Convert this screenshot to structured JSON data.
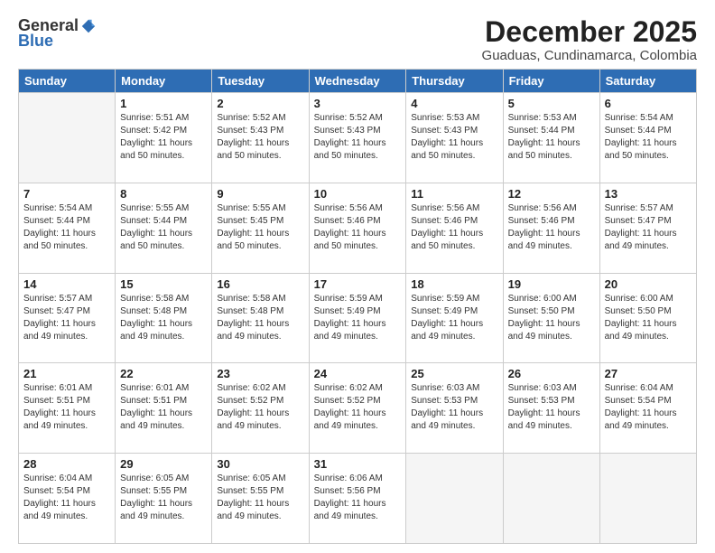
{
  "logo": {
    "general": "General",
    "blue": "Blue"
  },
  "title": "December 2025",
  "subtitle": "Guaduas, Cundinamarca, Colombia",
  "weekdays": [
    "Sunday",
    "Monday",
    "Tuesday",
    "Wednesday",
    "Thursday",
    "Friday",
    "Saturday"
  ],
  "weeks": [
    [
      {
        "day": "",
        "info": ""
      },
      {
        "day": "1",
        "info": "Sunrise: 5:51 AM\nSunset: 5:42 PM\nDaylight: 11 hours\nand 50 minutes."
      },
      {
        "day": "2",
        "info": "Sunrise: 5:52 AM\nSunset: 5:43 PM\nDaylight: 11 hours\nand 50 minutes."
      },
      {
        "day": "3",
        "info": "Sunrise: 5:52 AM\nSunset: 5:43 PM\nDaylight: 11 hours\nand 50 minutes."
      },
      {
        "day": "4",
        "info": "Sunrise: 5:53 AM\nSunset: 5:43 PM\nDaylight: 11 hours\nand 50 minutes."
      },
      {
        "day": "5",
        "info": "Sunrise: 5:53 AM\nSunset: 5:44 PM\nDaylight: 11 hours\nand 50 minutes."
      },
      {
        "day": "6",
        "info": "Sunrise: 5:54 AM\nSunset: 5:44 PM\nDaylight: 11 hours\nand 50 minutes."
      }
    ],
    [
      {
        "day": "7",
        "info": "Sunrise: 5:54 AM\nSunset: 5:44 PM\nDaylight: 11 hours\nand 50 minutes."
      },
      {
        "day": "8",
        "info": "Sunrise: 5:55 AM\nSunset: 5:44 PM\nDaylight: 11 hours\nand 50 minutes."
      },
      {
        "day": "9",
        "info": "Sunrise: 5:55 AM\nSunset: 5:45 PM\nDaylight: 11 hours\nand 50 minutes."
      },
      {
        "day": "10",
        "info": "Sunrise: 5:56 AM\nSunset: 5:46 PM\nDaylight: 11 hours\nand 50 minutes."
      },
      {
        "day": "11",
        "info": "Sunrise: 5:56 AM\nSunset: 5:46 PM\nDaylight: 11 hours\nand 50 minutes."
      },
      {
        "day": "12",
        "info": "Sunrise: 5:56 AM\nSunset: 5:46 PM\nDaylight: 11 hours\nand 49 minutes."
      },
      {
        "day": "13",
        "info": "Sunrise: 5:57 AM\nSunset: 5:47 PM\nDaylight: 11 hours\nand 49 minutes."
      }
    ],
    [
      {
        "day": "14",
        "info": "Sunrise: 5:57 AM\nSunset: 5:47 PM\nDaylight: 11 hours\nand 49 minutes."
      },
      {
        "day": "15",
        "info": "Sunrise: 5:58 AM\nSunset: 5:48 PM\nDaylight: 11 hours\nand 49 minutes."
      },
      {
        "day": "16",
        "info": "Sunrise: 5:58 AM\nSunset: 5:48 PM\nDaylight: 11 hours\nand 49 minutes."
      },
      {
        "day": "17",
        "info": "Sunrise: 5:59 AM\nSunset: 5:49 PM\nDaylight: 11 hours\nand 49 minutes."
      },
      {
        "day": "18",
        "info": "Sunrise: 5:59 AM\nSunset: 5:49 PM\nDaylight: 11 hours\nand 49 minutes."
      },
      {
        "day": "19",
        "info": "Sunrise: 6:00 AM\nSunset: 5:50 PM\nDaylight: 11 hours\nand 49 minutes."
      },
      {
        "day": "20",
        "info": "Sunrise: 6:00 AM\nSunset: 5:50 PM\nDaylight: 11 hours\nand 49 minutes."
      }
    ],
    [
      {
        "day": "21",
        "info": "Sunrise: 6:01 AM\nSunset: 5:51 PM\nDaylight: 11 hours\nand 49 minutes."
      },
      {
        "day": "22",
        "info": "Sunrise: 6:01 AM\nSunset: 5:51 PM\nDaylight: 11 hours\nand 49 minutes."
      },
      {
        "day": "23",
        "info": "Sunrise: 6:02 AM\nSunset: 5:52 PM\nDaylight: 11 hours\nand 49 minutes."
      },
      {
        "day": "24",
        "info": "Sunrise: 6:02 AM\nSunset: 5:52 PM\nDaylight: 11 hours\nand 49 minutes."
      },
      {
        "day": "25",
        "info": "Sunrise: 6:03 AM\nSunset: 5:53 PM\nDaylight: 11 hours\nand 49 minutes."
      },
      {
        "day": "26",
        "info": "Sunrise: 6:03 AM\nSunset: 5:53 PM\nDaylight: 11 hours\nand 49 minutes."
      },
      {
        "day": "27",
        "info": "Sunrise: 6:04 AM\nSunset: 5:54 PM\nDaylight: 11 hours\nand 49 minutes."
      }
    ],
    [
      {
        "day": "28",
        "info": "Sunrise: 6:04 AM\nSunset: 5:54 PM\nDaylight: 11 hours\nand 49 minutes."
      },
      {
        "day": "29",
        "info": "Sunrise: 6:05 AM\nSunset: 5:55 PM\nDaylight: 11 hours\nand 49 minutes."
      },
      {
        "day": "30",
        "info": "Sunrise: 6:05 AM\nSunset: 5:55 PM\nDaylight: 11 hours\nand 49 minutes."
      },
      {
        "day": "31",
        "info": "Sunrise: 6:06 AM\nSunset: 5:56 PM\nDaylight: 11 hours\nand 49 minutes."
      },
      {
        "day": "",
        "info": ""
      },
      {
        "day": "",
        "info": ""
      },
      {
        "day": "",
        "info": ""
      }
    ]
  ]
}
